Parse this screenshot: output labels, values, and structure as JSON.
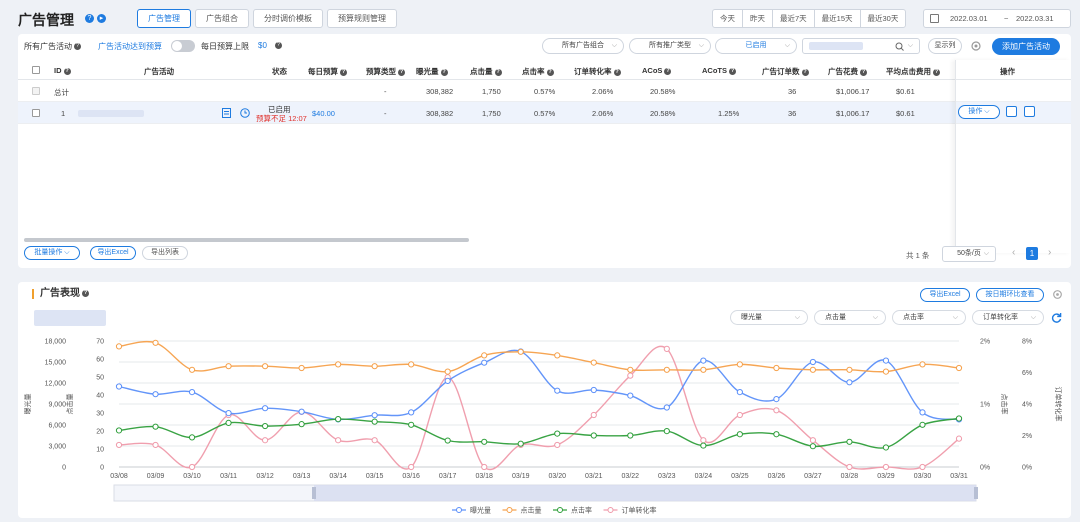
{
  "header": {
    "title": "广告管理",
    "tabs": [
      {
        "label": "广告管理",
        "active": true
      },
      {
        "label": "广告组合",
        "active": false
      },
      {
        "label": "分时调价模板",
        "active": false
      },
      {
        "label": "预算规则管理",
        "active": false
      }
    ],
    "ranges": [
      "今天",
      "昨天",
      "最近7天",
      "最近15天",
      "最近30天"
    ],
    "date_start": "2022.03.01",
    "date_sep": "~",
    "date_end": "2022.03.31"
  },
  "toolbar": {
    "all_campaigns": "所有广告活动",
    "budget_label": "广告活动达到预算",
    "daily_cap": "每日预算上限",
    "daily_cap_value": "$0",
    "select_portfolio": "所有广告组合",
    "select_type": "所有推广类型",
    "select_status": "已启用",
    "show_columns": "显示列",
    "add_campaign": "添加广告活动"
  },
  "table": {
    "headers": [
      "ID",
      "广告活动",
      "状态",
      "每日预算",
      "预算类型",
      "曝光量",
      "点击量",
      "点击率",
      "订单转化率",
      "ACoS",
      "ACoTS",
      "广告订单数",
      "广告花费",
      "平均点击费用",
      "操作"
    ],
    "total_row": {
      "label": "总计",
      "budget_type": "-",
      "impressions": "308,382",
      "clicks": "1,750",
      "ctr": "0.57%",
      "cvr": "2.06%",
      "acos": "20.58%",
      "acots": "",
      "orders": "36",
      "spend": "$1,006.17",
      "cpc": "$0.61"
    },
    "rows": [
      {
        "id": "1",
        "status": "已启用",
        "status_note": "预算不足 12:07",
        "budget": "$40.00",
        "budget_type": "-",
        "impressions": "308,382",
        "clicks": "1,750",
        "ctr": "0.57%",
        "cvr": "2.06%",
        "acos": "20.58%",
        "acots": "1.25%",
        "orders": "36",
        "spend": "$1,006.17",
        "cpc": "$0.61",
        "action": "操作"
      }
    ]
  },
  "footer": {
    "batch": "批量操作",
    "export_excel": "导出Excel",
    "export_list": "导出列表",
    "total": "共 1 条",
    "per_page": "50条/页",
    "page_current": "1",
    "prev": "‹",
    "next": "›"
  },
  "performance": {
    "title": "广告表现",
    "export_excel": "导出Excel",
    "compare": "按日期环比查看",
    "metric_selects": [
      "曝光量",
      "点击量",
      "点击率",
      "订单转化率"
    ]
  },
  "chart_data": {
    "type": "line",
    "x": [
      "03/08",
      "03/09",
      "03/10",
      "03/11",
      "03/12",
      "03/13",
      "03/14",
      "03/15",
      "03/16",
      "03/17",
      "03/18",
      "03/19",
      "03/20",
      "03/21",
      "03/22",
      "03/23",
      "03/24",
      "03/25",
      "03/26",
      "03/27",
      "03/28",
      "03/29",
      "03/30",
      "03/31"
    ],
    "axes": {
      "impressions": {
        "ticks": [
          "0",
          "3,000",
          "6,000",
          "9,000",
          "12,000",
          "15,000",
          "18,000"
        ],
        "range": [
          0,
          18000
        ],
        "label": "曝光量"
      },
      "clicks": {
        "ticks": [
          "0",
          "10",
          "20",
          "30",
          "40",
          "50",
          "60",
          "70"
        ],
        "range": [
          0,
          70
        ],
        "label": "点击量"
      },
      "ctr": {
        "ticks": [
          "0%",
          "1%",
          "2%"
        ],
        "range": [
          0,
          2
        ],
        "label": "点击率"
      },
      "cvr": {
        "ticks": [
          "0%",
          "2%",
          "4%",
          "6%",
          "8%"
        ],
        "range": [
          0,
          8
        ],
        "label": "订单转化率"
      }
    },
    "series": [
      {
        "name": "曝光量",
        "color": "#5b8ff9",
        "axis": "impressions",
        "values": [
          11500,
          10400,
          10700,
          7700,
          8400,
          7900,
          6800,
          7400,
          7800,
          12300,
          14900,
          16500,
          10900,
          11000,
          10200,
          8500,
          15200,
          10700,
          9700,
          15000,
          12100,
          15200,
          7800,
          6800
        ]
      },
      {
        "name": "点击量",
        "color": "#f5a04a",
        "axis": "clicks",
        "values": [
          67,
          69,
          54,
          56,
          56,
          55,
          57,
          56,
          57,
          53,
          62,
          64,
          62,
          58,
          54,
          54,
          54,
          57,
          55,
          54,
          54,
          53,
          57,
          55
        ]
      },
      {
        "name": "点击率",
        "color": "#2e9e3a",
        "axis": "ctr",
        "values": [
          0.58,
          0.64,
          0.47,
          0.7,
          0.65,
          0.68,
          0.76,
          0.72,
          0.67,
          0.42,
          0.4,
          0.37,
          0.53,
          0.5,
          0.5,
          0.57,
          0.34,
          0.52,
          0.52,
          0.33,
          0.4,
          0.31,
          0.67,
          0.77
        ]
      },
      {
        "name": "订单转化率",
        "color": "#ef9aaa",
        "axis": "cvr",
        "values": [
          1.4,
          1.4,
          0,
          3.3,
          1.7,
          3.5,
          1.7,
          1.7,
          0,
          5.7,
          0,
          1.4,
          1.4,
          3.3,
          5.8,
          7.5,
          1.7,
          3.3,
          3.6,
          1.7,
          0,
          0,
          0,
          1.8
        ]
      }
    ]
  }
}
